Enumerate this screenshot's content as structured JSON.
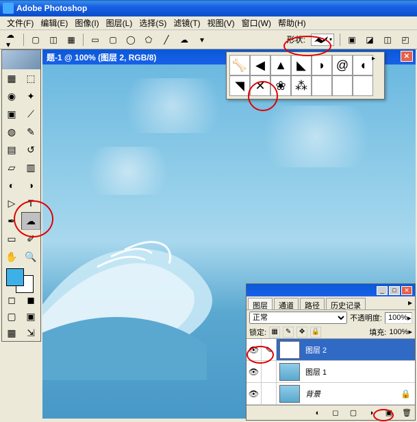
{
  "app": {
    "title": "Adobe Photoshop"
  },
  "menu": {
    "file": "文件(F)",
    "edit": "编辑(E)",
    "image": "图像(I)",
    "layer": "图层(L)",
    "select": "选择(S)",
    "filter": "滤镜(T)",
    "view": "视图(V)",
    "window": "窗口(W)",
    "help": "帮助(H)"
  },
  "options": {
    "shape_label": "形状:"
  },
  "document": {
    "title": "题-1 @ 100% (图层 2, RGB/8)"
  },
  "toolbox": {
    "tools": [
      [
        "move",
        "▦"
      ],
      [
        "marquee",
        "⬚"
      ],
      [
        "lasso",
        "◉"
      ],
      [
        "wand",
        "✦"
      ],
      [
        "crop",
        "▣"
      ],
      [
        "slice",
        "⟋"
      ],
      [
        "heal",
        "◍"
      ],
      [
        "brush",
        "✎"
      ],
      [
        "stamp",
        "▤"
      ],
      [
        "history",
        "↺"
      ],
      [
        "eraser",
        "▱"
      ],
      [
        "gradient",
        "▥"
      ],
      [
        "blur",
        "◐"
      ],
      [
        "dodge",
        "◑"
      ],
      [
        "path",
        "▷"
      ],
      [
        "type",
        "T"
      ],
      [
        "pen",
        "✒"
      ],
      [
        "shape",
        "☁"
      ],
      [
        "notes",
        "▭"
      ],
      [
        "eyedrop",
        "✐"
      ],
      [
        "hand",
        "✋"
      ],
      [
        "zoom",
        "🔍"
      ]
    ]
  },
  "shapes_panel": {
    "row1": [
      {
        "name": "bone",
        "g": "🦴"
      },
      {
        "name": "fish",
        "g": "◀"
      },
      {
        "name": "cat",
        "g": "▲"
      },
      {
        "name": "dog",
        "g": "◣"
      },
      {
        "name": "rabbit",
        "g": "◗"
      },
      {
        "name": "snail",
        "g": "@"
      },
      {
        "name": "rabbit2",
        "g": "◖"
      }
    ],
    "row2": [
      {
        "name": "crow",
        "g": "◥"
      },
      {
        "name": "butterfly",
        "g": "✕"
      },
      {
        "name": "paw",
        "g": "❀"
      },
      {
        "name": "paw2",
        "g": "⁂"
      }
    ]
  },
  "layers": {
    "tabs": [
      "图层",
      "通道",
      "路径",
      "历史记录"
    ],
    "blend_mode": "正常",
    "opacity_label": "不透明度:",
    "opacity_value": "100%",
    "lock_label": "锁定:",
    "fill_label": "填充:",
    "fill_value": "100%",
    "items": [
      {
        "name": "图层 2",
        "selected": true,
        "thumb": "checker"
      },
      {
        "name": "图层 1",
        "selected": false,
        "thumb": "sky"
      },
      {
        "name": "背景",
        "selected": false,
        "thumb": "sky",
        "locked": true,
        "italic": true
      }
    ]
  }
}
